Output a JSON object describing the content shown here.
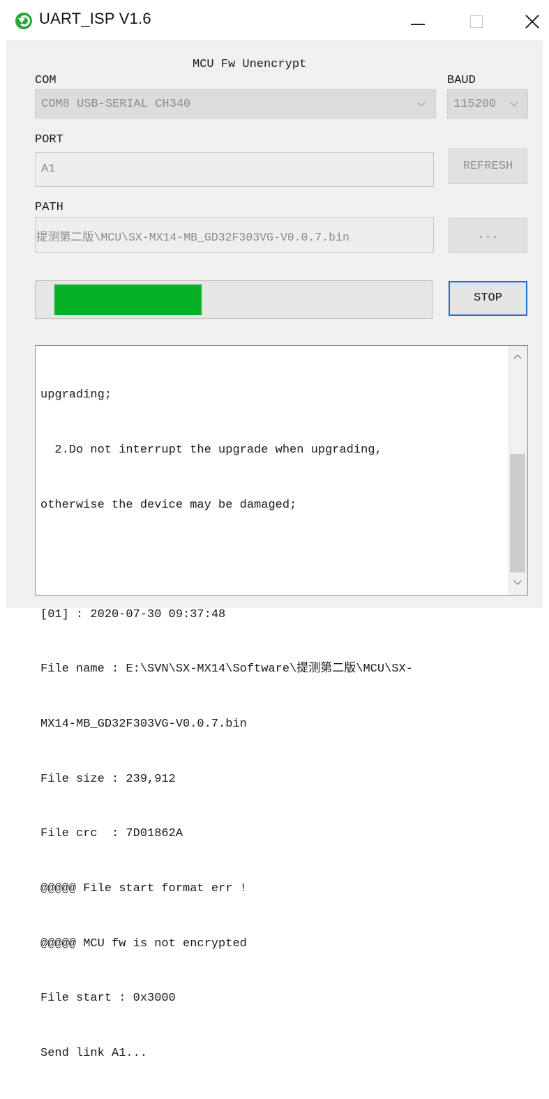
{
  "window": {
    "title": "UART_ISP V1.6",
    "app_icon": "refresh-arrow-icon"
  },
  "header": {
    "mode_label": "MCU Fw Unencrypt"
  },
  "com": {
    "label": "COM",
    "value": "COM8 USB-SERIAL CH340"
  },
  "baud": {
    "label": "BAUD",
    "value": "115200"
  },
  "port": {
    "label": "PORT",
    "value": "A1",
    "refresh_label": "REFRESH"
  },
  "path": {
    "label": "PATH",
    "value": "提测第二版\\MCU\\SX-MX14-MB_GD32F303VG-V0.0.7.bin",
    "browse_label": "..."
  },
  "progress": {
    "fraction": 0.37,
    "color": "#06b025"
  },
  "stop_label": "STOP",
  "log": {
    "lines": [
      "upgrading;",
      "  2.Do not interrupt the upgrade when upgrading,",
      "otherwise the device may be damaged;",
      "",
      "[01] : 2020-07-30 09:37:48",
      "File name : E:\\SVN\\SX-MX14\\Software\\提测第二版\\MCU\\SX-",
      "MX14-MB_GD32F303VG-V0.0.7.bin",
      "File size : 239,912",
      "File crc  : 7D01862A",
      "@@@@@ File start format err !",
      "@@@@@ MCU fw is not encrypted",
      "File start : 0x3000",
      "Send link A1..."
    ]
  }
}
